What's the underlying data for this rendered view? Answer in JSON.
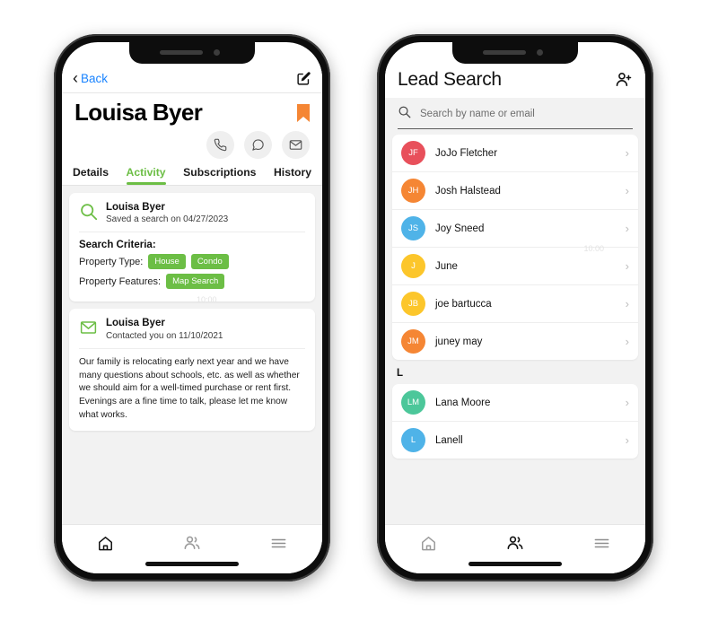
{
  "left_phone": {
    "navbar": {
      "back_label": "Back",
      "back_icon": "chevron-left-icon",
      "compose_icon": "compose-edit-icon"
    },
    "lead": {
      "name": "Louisa Byer",
      "bookmark_icon": "bookmark-icon",
      "bookmark_color": "#F58634"
    },
    "quick_actions": [
      {
        "name": "call-button",
        "icon": "phone-icon"
      },
      {
        "name": "message-button",
        "icon": "chat-bubble-icon"
      },
      {
        "name": "email-button",
        "icon": "envelope-icon"
      }
    ],
    "tabs": [
      {
        "label": "Details",
        "active": false
      },
      {
        "label": "Activity",
        "active": true
      },
      {
        "label": "Subscriptions",
        "active": false
      },
      {
        "label": "History",
        "active": false
      }
    ],
    "accent_color": "#6CBE45",
    "activity": [
      {
        "icon": "search-icon",
        "title": "Louisa Byer",
        "subtitle": "Saved a search on 04/27/2023",
        "criteria_heading": "Search Criteria:",
        "criteria": [
          {
            "label": "Property Type:",
            "chips": [
              "House",
              "Condo"
            ]
          },
          {
            "label": "Property Features:",
            "chips": [
              "Map Search"
            ]
          }
        ]
      },
      {
        "icon": "envelope-icon",
        "title": "Louisa Byer",
        "subtitle": "Contacted you on 11/10/2021",
        "message": " Our family is relocating early next year and we have many questions about schools, etc. as well as whether we should aim for a well-timed purchase or rent first. Evenings are a fine time to talk, please let me know what works."
      }
    ],
    "watermark": "10:00",
    "tabbar": [
      {
        "name": "tab-home",
        "icon": "home-icon",
        "active": true
      },
      {
        "name": "tab-people",
        "icon": "people-icon",
        "active": false
      },
      {
        "name": "tab-menu",
        "icon": "hamburger-menu-icon",
        "active": false
      }
    ]
  },
  "right_phone": {
    "header": {
      "title": "Lead Search",
      "add_icon": "add-person-icon"
    },
    "search": {
      "placeholder": "Search by name or email",
      "value": "",
      "icon": "search-icon"
    },
    "watermark": "10:00",
    "groups": [
      {
        "section": "",
        "rows": [
          {
            "initials": "JF",
            "name": "JoJo Fletcher",
            "color": "#E8505B"
          },
          {
            "initials": "JH",
            "name": "Josh Halstead",
            "color": "#F58634"
          },
          {
            "initials": "JS",
            "name": "Joy Sneed",
            "color": "#4FB3E8"
          },
          {
            "initials": "J",
            "name": "June",
            "color": "#FCC62B"
          },
          {
            "initials": "JB",
            "name": "joe bartucca",
            "color": "#FCC62B"
          },
          {
            "initials": "JM",
            "name": "juney may",
            "color": "#F58634"
          }
        ]
      },
      {
        "section": "L",
        "rows": [
          {
            "initials": "LM",
            "name": "Lana Moore",
            "color": "#4CC79A"
          },
          {
            "initials": "L",
            "name": "Lanell",
            "color": "#4FB3E8"
          }
        ]
      }
    ],
    "chevron": "›",
    "tabbar": [
      {
        "name": "tab-home",
        "icon": "home-icon",
        "active": false
      },
      {
        "name": "tab-people",
        "icon": "people-icon",
        "active": true
      },
      {
        "name": "tab-menu",
        "icon": "hamburger-menu-icon",
        "active": false
      }
    ]
  }
}
